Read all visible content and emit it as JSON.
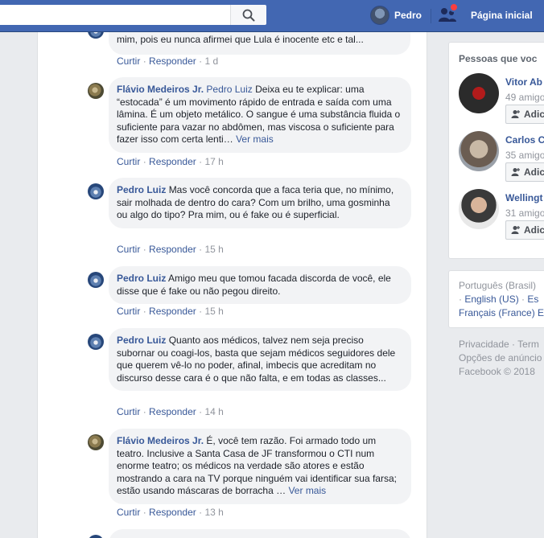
{
  "header": {
    "search_placeholder": "",
    "profile_name": "Pedro",
    "home_label": "Página inicial"
  },
  "comments": [
    {
      "author": "",
      "text_tail": "mim, pois eu nunca afirmei que Lula é inocente etc e tal...",
      "reply_label": "Curtir",
      "respond_label": "Responder",
      "time": "1 d"
    },
    {
      "author": "Flávio Medeiros Jr.",
      "mention": "Pedro Luiz",
      "text": "Deixa eu te explicar: uma “estocada” é um movimento rápido de entrada e saída com uma lâmina. É um objeto metálico. O sangue é uma substância fluida o suficiente para vazar no abdômen, mas viscosa o suficiente para fazer isso com certa lenti…",
      "see_more": "Ver mais",
      "like_label": "Curtir",
      "respond_label": "Responder",
      "time": "17 h"
    },
    {
      "author": "Pedro Luiz",
      "text": "Mas você concorda que a faca teria que, no mínimo, sair molhada de dentro do cara? Com um brilho, uma gosminha ou algo do tipo? Pra mim, ou é fake ou é superficial.",
      "like_label": "Curtir",
      "respond_label": "Responder",
      "time": "15 h"
    },
    {
      "author": "Pedro Luiz",
      "text": "Amigo meu que tomou facada discorda de você, ele disse que é fake ou não pegou direito.",
      "like_label": "Curtir",
      "respond_label": "Responder",
      "time": "15 h"
    },
    {
      "author": "Pedro Luiz",
      "text": "Quanto aos médicos, talvez nem seja preciso subornar ou coagi-los, basta que sejam médicos seguidores dele que querem vê-lo no poder, afinal, imbecis que acreditam no discurso desse cara é o que não falta, e em todas as classes...",
      "like_label": "Curtir",
      "respond_label": "Responder",
      "time": "14 h"
    },
    {
      "author": "Flávio Medeiros Jr.",
      "text": "É, você tem razão. Foi armado todo um teatro. Inclusive a Santa Casa de JF transformou o CTI num enorme teatro; os médicos na verdade são atores e estão mostrando a cara na TV porque ninguém vai identificar sua farsa; estão usando máscaras de borracha …",
      "see_more": "Ver mais",
      "like_label": "Curtir",
      "respond_label": "Responder",
      "time": "13 h"
    }
  ],
  "sidebar": {
    "title": "Pessoas que voc",
    "people": [
      {
        "name": "Vitor Ab",
        "mutual": "49 amigo",
        "add_label": "Adic"
      },
      {
        "name": "Carlos C",
        "mutual": "35 amigo",
        "add_label": "Adic"
      },
      {
        "name": "Wellingt",
        "mutual": "31 amigo",
        "add_label": "Adic"
      }
    ],
    "languages": {
      "current": "Português (Brasil)",
      "english": "English (US)",
      "sep": "·",
      "other": "Es",
      "french": "Français (France)",
      "extra": "E"
    },
    "footer": {
      "privacy": "Privacidade",
      "dot": "·",
      "terms": "Term",
      "ads": "Opções de anúncio",
      "copyright": "Facebook © 2018"
    }
  },
  "colors": {
    "topbar": "#4267b2",
    "link": "#385898",
    "bubble": "#f2f3f5",
    "page_bg": "#e9ebee"
  }
}
